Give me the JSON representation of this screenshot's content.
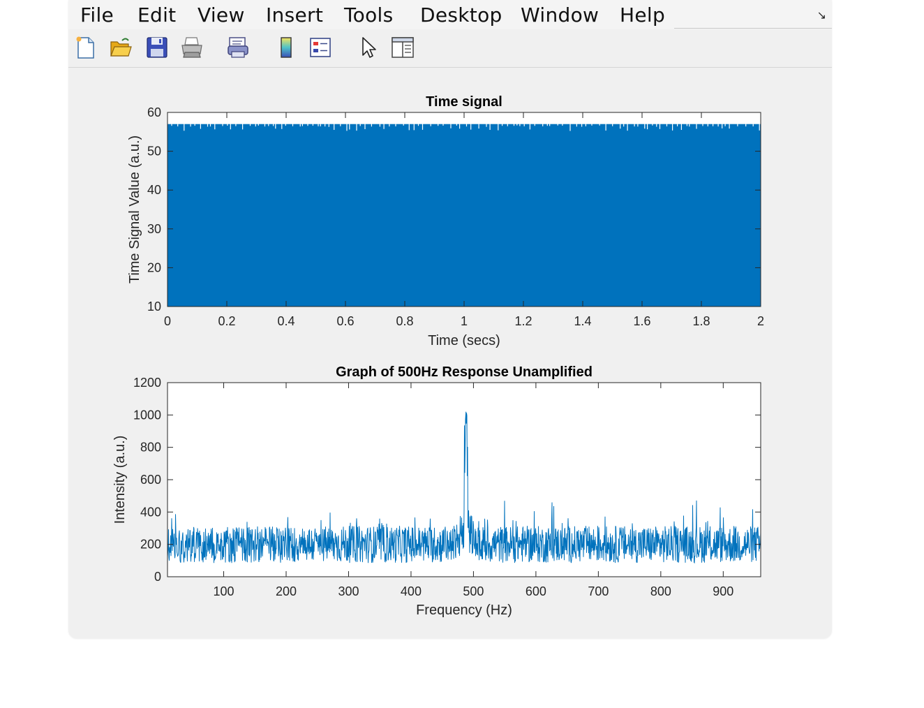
{
  "menu": {
    "items": [
      "File",
      "Edit",
      "View",
      "Insert",
      "Tools",
      "Desktop",
      "Window",
      "Help"
    ]
  },
  "toolbar": {
    "buttons": [
      {
        "name": "new-figure-button",
        "icon": "new-document-icon"
      },
      {
        "name": "open-file-button",
        "icon": "folder-open-icon"
      },
      {
        "name": "save-figure-button",
        "icon": "floppy-disk-icon"
      },
      {
        "name": "print-figure-button",
        "icon": "printer-icon"
      },
      {
        "name": "link-plot-button",
        "icon": "link-plot-icon"
      },
      {
        "name": "insert-colorbar-button",
        "icon": "colorbar-icon"
      },
      {
        "name": "insert-legend-button",
        "icon": "legend-icon"
      },
      {
        "name": "edit-plot-button",
        "icon": "pointer-arrow-icon"
      },
      {
        "name": "property-inspector-button",
        "icon": "property-inspector-icon"
      }
    ]
  },
  "colors": {
    "series": "#0072bd",
    "window_bg": "#f0f0f0",
    "axes_bg": "#ffffff"
  },
  "chart_data": [
    {
      "type": "area",
      "title": "Time signal",
      "xlabel": "Time (secs)",
      "ylabel": "Time Signal Value (a.u.)",
      "xlim": [
        0,
        2
      ],
      "ylim": [
        10,
        60
      ],
      "xticks": [
        0,
        0.2,
        0.4,
        0.6,
        0.8,
        1,
        1.2,
        1.4,
        1.6,
        1.8,
        2
      ],
      "xtick_labels": [
        "0",
        "0.2",
        "0.4",
        "0.6",
        "0.8",
        "1",
        "1.2",
        "1.4",
        "1.6",
        "1.8",
        "2"
      ],
      "yticks": [
        10,
        20,
        30,
        40,
        50,
        60
      ],
      "ytick_labels": [
        "10",
        "20",
        "30",
        "40",
        "50",
        "60"
      ],
      "signal_min": 10,
      "signal_max": 57,
      "grid": false
    },
    {
      "type": "line",
      "title": "Graph of 500Hz Response Unamplified",
      "xlabel": "Frequency (Hz)",
      "ylabel": "Intensity (a.u.)",
      "xlim": [
        10,
        960
      ],
      "ylim": [
        0,
        1200
      ],
      "xticks": [
        100,
        200,
        300,
        400,
        500,
        600,
        700,
        800,
        900
      ],
      "xtick_labels": [
        "100",
        "200",
        "300",
        "400",
        "500",
        "600",
        "700",
        "800",
        "900"
      ],
      "yticks": [
        0,
        200,
        400,
        600,
        800,
        1000,
        1200
      ],
      "ytick_labels": [
        "0",
        "200",
        "400",
        "600",
        "800",
        "1000",
        "1200"
      ],
      "peak": {
        "x": 488,
        "y": 1020
      },
      "noise_mean": 200,
      "noise_max": 500,
      "grid": false
    }
  ]
}
